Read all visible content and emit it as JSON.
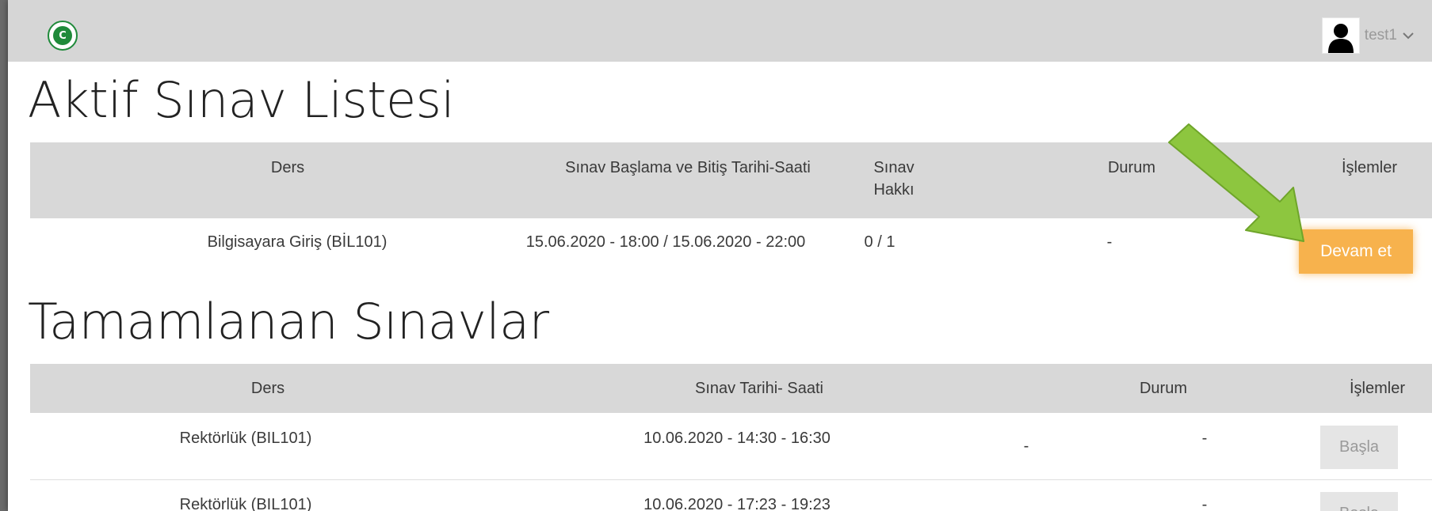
{
  "navbar": {
    "logo_letter": "C",
    "username": "test1",
    "user_icon": "user-silhouette-icon",
    "dropdown_icon": "chevron-down-icon"
  },
  "active": {
    "title": "Aktif Sınav Listesi",
    "headers": {
      "course": "Ders",
      "datetime": "Sınav Başlama ve Bitiş Tarihi-Saati",
      "attempt_line1": "Sınav",
      "attempt_line2": "Hakkı",
      "status": "Durum",
      "actions": "İşlemler"
    },
    "rows": [
      {
        "course": "Bilgisayara Giriş (BİL101)",
        "datetime": "15.06.2020 - 18:00 / 15.06.2020 - 22:00",
        "attempt": "0 / 1",
        "status": "-",
        "action": "Devam et"
      }
    ]
  },
  "completed": {
    "title": "Tamamlanan Sınavlar",
    "headers": {
      "course": "Ders",
      "datetime": "Sınav Tarihi- Saati",
      "status": "Durum",
      "actions": "İşlemler"
    },
    "rows": [
      {
        "course": "Rektörlük (BIL101)",
        "datetime": "10.06.2020 - 14:30 - 16:30",
        "status_a": "-",
        "status_b": "-",
        "action": "Başla"
      },
      {
        "course": "Rektörlük (BIL101)",
        "datetime": "10.06.2020 - 17:23 - 19:23",
        "status_a": "",
        "status_b": "-",
        "action": "Başla"
      }
    ]
  },
  "colors": {
    "navbar": "#d6d6d6",
    "table_header": "#d8d8d8",
    "devam_button": "#f7b24d",
    "arrow": "#8dc63f",
    "logo": "#1f8a3a"
  },
  "annotation_icon": "green-arrow-icon"
}
